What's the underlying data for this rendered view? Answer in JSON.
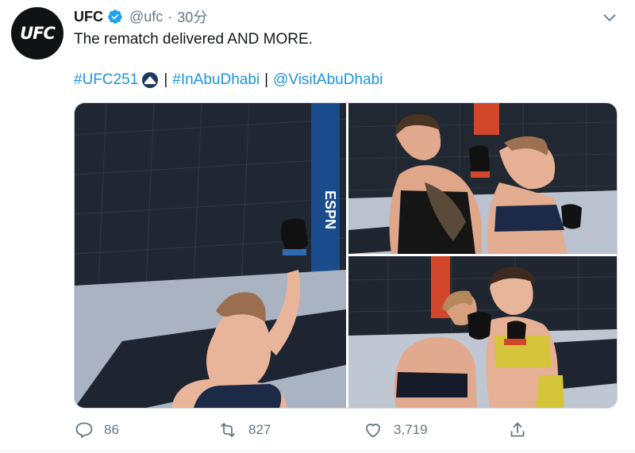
{
  "account": {
    "avatar_text": "UFC",
    "display_name": "UFC",
    "handle": "@ufc",
    "separator": "·",
    "time": "30分",
    "verified_icon": "verified-badge-icon"
  },
  "tweet": {
    "text": "The rematch delivered AND MORE.",
    "hashtags": [
      "#UFC251",
      "#InAbuDhabi",
      "@VisitAbuDhabi"
    ],
    "link_separator": "|"
  },
  "media": {
    "photos": [
      {
        "name": "photo-fighter-raising-fist",
        "scene": "fighter with bloody nose raising gloved fist in octagon"
      },
      {
        "name": "photo-fighters-clinch",
        "scene": "two fighters in clinch exchange"
      },
      {
        "name": "photo-fighters-punch",
        "scene": "fighter landing punch during clinch"
      }
    ]
  },
  "actions": {
    "reply_count": "86",
    "retweet_count": "827",
    "like_count": "3,719"
  },
  "colors": {
    "link": "#1b95e0",
    "text": "#14171a",
    "secondary": "#657786",
    "verified": "#1da1f2"
  }
}
